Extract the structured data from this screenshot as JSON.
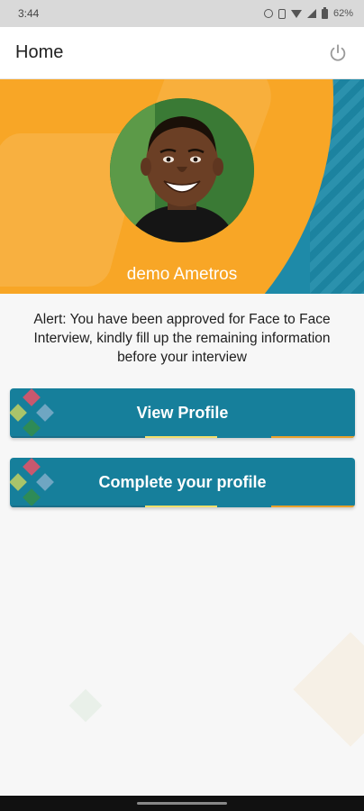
{
  "status_bar": {
    "time": "3:44",
    "battery_text": "62%"
  },
  "app_bar": {
    "title": "Home",
    "power_icon": "power-icon"
  },
  "profile": {
    "name": "demo Ametros",
    "avatar_icon": "profile-photo"
  },
  "alert": {
    "text": "Alert: You have been approved for Face to Face Interview, kindly fill up the remaining information before your interview"
  },
  "buttons": {
    "view_profile": "View Profile",
    "complete_profile": "Complete your profile"
  },
  "colors": {
    "primary_teal": "#167f9b",
    "accent_orange": "#f8a626"
  }
}
